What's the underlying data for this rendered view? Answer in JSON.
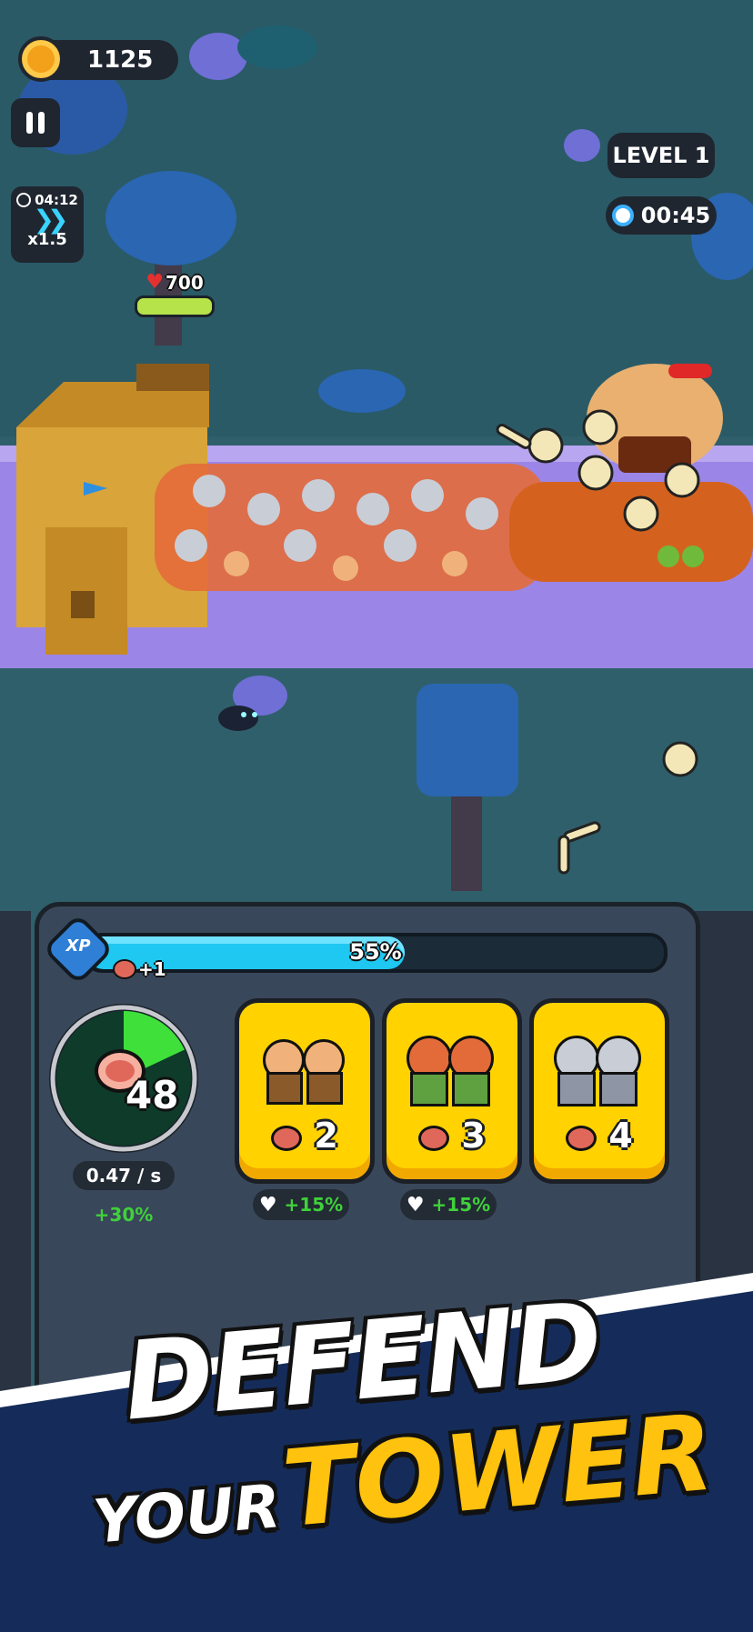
{
  "hud": {
    "coins": "1125",
    "level": "LEVEL 1",
    "timer": "00:45",
    "speed_time": "04:12",
    "speed_mult": "x1.5",
    "tower_hp": "700"
  },
  "xp": {
    "badge": "XP",
    "percent_label": "55%",
    "progress": 0.55,
    "meat_bonus": "+1"
  },
  "meat": {
    "count": "48",
    "rate": "0.47 / s",
    "boost": "+30%",
    "fill": 0.18
  },
  "units": [
    {
      "cost": "2",
      "buff": "+15%",
      "icon": "peasant-units-icon"
    },
    {
      "cost": "3",
      "buff": "+15%",
      "icon": "archer-units-icon"
    },
    {
      "cost": "4",
      "buff": "",
      "icon": "knight-units-icon"
    }
  ],
  "promo": {
    "line1": "DEFEND",
    "line2_a": "YOUR",
    "line2_b": "TOWER"
  },
  "colors": {
    "accent_yellow": "#ffd200",
    "xp_blue": "#1ec8f0",
    "meat_green": "#3fd13a"
  }
}
